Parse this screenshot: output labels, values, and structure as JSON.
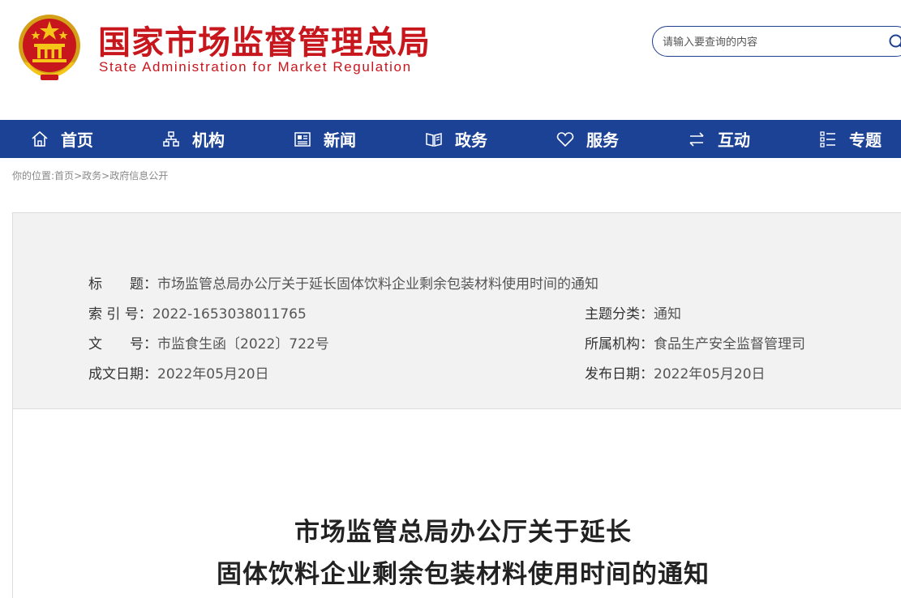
{
  "header": {
    "title": "国家市场监督管理总局",
    "subtitle": "State Administration for Market Regulation",
    "emblem_icon": "national-emblem-icon",
    "brand_color": "#c8161d"
  },
  "search": {
    "placeholder": "请输入要查询的内容",
    "icon": "search-icon"
  },
  "nav": {
    "bg_color": "#1c4295",
    "items": [
      {
        "label": "首页",
        "icon": "home-icon"
      },
      {
        "label": "机构",
        "icon": "org-chart-icon"
      },
      {
        "label": "新闻",
        "icon": "newspaper-icon"
      },
      {
        "label": "政务",
        "icon": "open-book-icon"
      },
      {
        "label": "服务",
        "icon": "heart-icon"
      },
      {
        "label": "互动",
        "icon": "exchange-icon"
      },
      {
        "label": "专题",
        "icon": "list-icon"
      }
    ]
  },
  "breadcrumb": {
    "prefix": "你的位置:",
    "items": [
      "首页",
      "政务",
      "政府信息公开"
    ],
    "separator": ">"
  },
  "info": {
    "title_key": "标　　题：",
    "title_value": "市场监管总局办公厅关于延长固体饮料企业剩余包装材料使用时间的通知",
    "index_key": "索 引 号：",
    "index_value": "2022-1653038011765",
    "topic_key": "主题分类：",
    "topic_value": "通知",
    "docno_key": "文　　号：",
    "docno_value": "市监食生函〔2022〕722号",
    "org_key": "所属机构：",
    "org_value": "食品生产安全监督管理司",
    "created_key": "成文日期：",
    "created_value": "2022年05月20日",
    "published_key": "发布日期：",
    "published_value": "2022年05月20日"
  },
  "article": {
    "title_line1": "市场监管总局办公厅关于延长",
    "title_line2": "固体饮料企业剩余包装材料使用时间的通知"
  }
}
